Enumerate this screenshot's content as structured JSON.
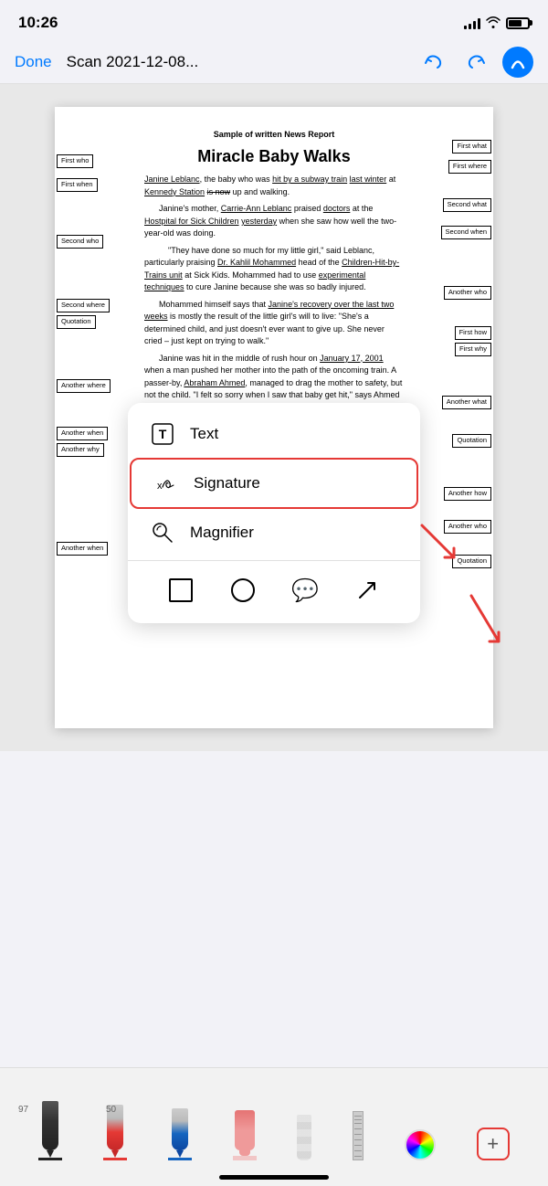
{
  "statusBar": {
    "time": "10:26"
  },
  "toolbar": {
    "done": "Done",
    "title": "Scan 2021-12-08...",
    "undoIcon": "↩",
    "redoIcon": "↪",
    "arcIcon": "A"
  },
  "document": {
    "sampleTitle": "Sample of written News Report",
    "headline": "Miracle Baby Walks",
    "paragraphs": [
      "Janine Leblanc, the baby who was hit by a subway train last winter at Kennedy Station is now up and walking.",
      "Janine's mother, Carrie-Ann Leblanc praised doctors at the Hostpital for Sick Children yesterday when she saw how well the two-year-old was doing.",
      "\"They have done so much for my little girl,\" said Leblanc, particularly praising Dr. Kahlil Mohammed head of the Children-Hit-by-Trains unit at Sick Kids. Mohammed had to use experimental techniques to cure Janine because she was so badly injured.",
      "Mohammed himself says that Janine's recovery over the last two weeks is mostly the result of the little girl's will to live: \"She's a determined child, and just doesn't ever want to give up. She never cried – just kept on trying to walk.\"",
      "Janine was hit in the middle of rush hour on January 17, 2001 when a man pushed her mother into the path of the oncoming train. A passer-by, Abraham Ahmed, managed to drag the mother to safety, but not the child. \"I felt so sorry when I saw that baby get hit,\" says Ahmed who was given a medal for his bravery."
    ],
    "labels": {
      "left": [
        "First who",
        "First when",
        "Second who",
        "Second where",
        "Quotation",
        "Another where",
        "Another when",
        "Another why",
        "Another when"
      ],
      "right": [
        "First what",
        "First where",
        "Second what",
        "Second when",
        "Another who",
        "First how",
        "First why",
        "Another what",
        "Quotation",
        "Another how",
        "Another who",
        "Quotation"
      ]
    }
  },
  "popupMenu": {
    "items": [
      {
        "id": "text",
        "icon": "T",
        "label": "Text"
      },
      {
        "id": "signature",
        "icon": "✍",
        "label": "Signature",
        "highlighted": true
      },
      {
        "id": "magnifier",
        "icon": "🔍",
        "label": "Magnifier"
      }
    ],
    "shapes": [
      "square",
      "circle",
      "speech",
      "arrow"
    ]
  },
  "bottomBar": {
    "numbers": [
      "97",
      "50"
    ],
    "tools": [
      "pen-black",
      "pen-red",
      "pen-blue",
      "marker-pink",
      "pencil",
      "ruler",
      "color-wheel",
      "add"
    ]
  }
}
